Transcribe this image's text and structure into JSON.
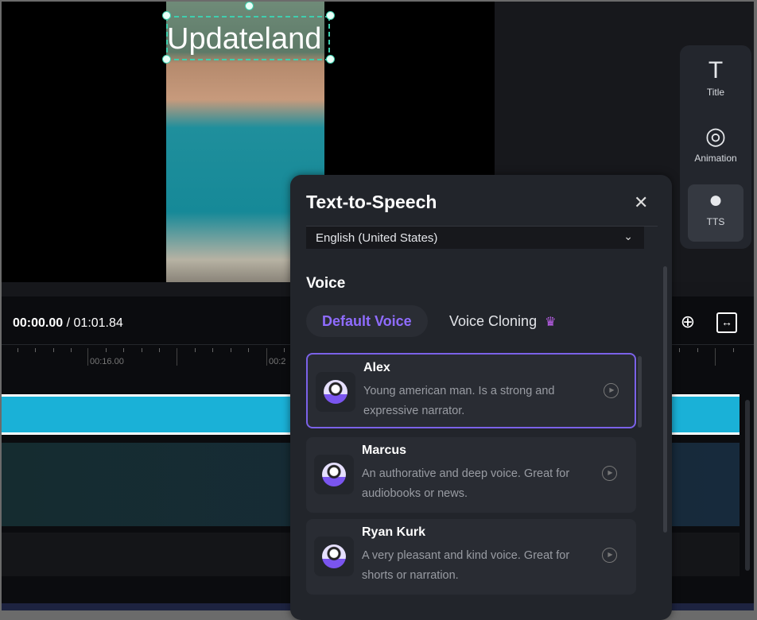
{
  "preview": {
    "overlay_text": "Updateland"
  },
  "toolbar": {
    "items": [
      {
        "label": "Title",
        "icon": "title-icon"
      },
      {
        "label": "Animation",
        "icon": "animation-icon"
      },
      {
        "label": "TTS",
        "icon": "microphone-icon",
        "active": true
      }
    ]
  },
  "timeline": {
    "current": "00:00.00",
    "separator": " / ",
    "total": "01:01.84",
    "ruler_labels": [
      "00:16.00",
      "00:2"
    ]
  },
  "tts": {
    "title": "Text-to-Speech",
    "language": "English (United States)",
    "voice_heading": "Voice",
    "tabs": [
      {
        "label": "Default Voice",
        "active": true
      },
      {
        "label": "Voice Cloning",
        "premium": true
      }
    ],
    "voices": [
      {
        "name": "Alex",
        "description": "Young american man. Is a strong and expressive narrator.",
        "selected": true
      },
      {
        "name": "Marcus",
        "description": "An authorative and deep voice. Great for audiobooks or news."
      },
      {
        "name": "Ryan Kurk",
        "description": "A very pleasant and kind voice. Great for shorts or narration."
      }
    ]
  },
  "colors": {
    "accent": "#7b62e8",
    "clip": "#1ab1d7",
    "selection": "#3fcfae"
  }
}
